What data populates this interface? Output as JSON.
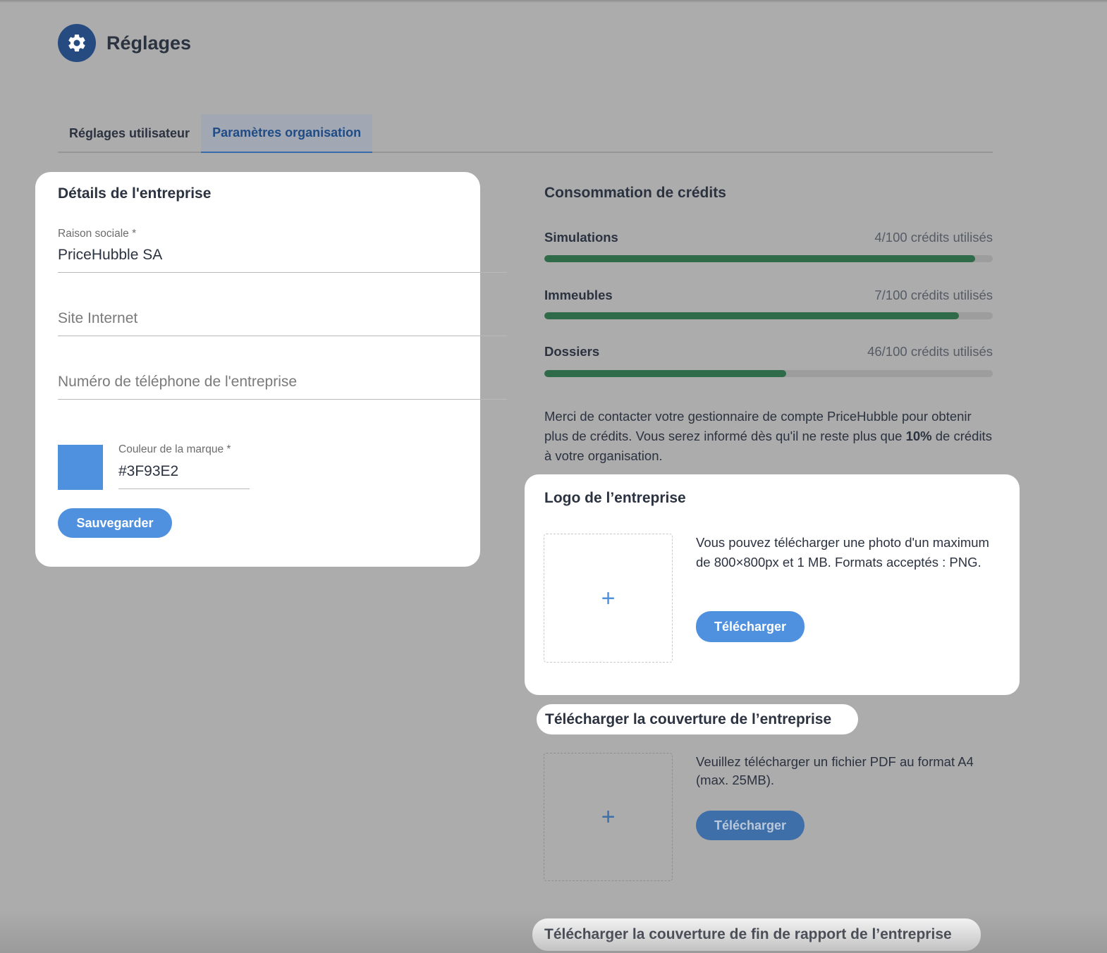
{
  "header": {
    "title": "Réglages",
    "icon": "gear-icon"
  },
  "tabs": [
    {
      "label": "Réglages utilisateur",
      "active": false
    },
    {
      "label": "Paramètres organisation",
      "active": true
    }
  ],
  "company_details": {
    "title": "Détails de l'entreprise",
    "company_name": {
      "label": "Raison sociale *",
      "value": "PriceHubble SA"
    },
    "website": {
      "placeholder": "Site Internet"
    },
    "phone": {
      "placeholder": "Numéro de téléphone de l'entreprise"
    },
    "brand_color": {
      "label": "Couleur de la marque *",
      "value": "#3F93E2",
      "swatch": "#4f90df"
    },
    "save_button": "Sauvegarder"
  },
  "credits": {
    "title": "Consommation de crédits",
    "items": [
      {
        "name": "Simulations",
        "usage": "4/100 crédits utilisés",
        "fill_percent": 96
      },
      {
        "name": "Immeubles",
        "usage": "7/100 crédits utilisés",
        "fill_percent": 92.5
      },
      {
        "name": "Dossiers",
        "usage": "46/100 crédits utilisés",
        "fill_percent": 54
      }
    ],
    "note_part1": "Merci de contacter votre gestionnaire de compte PriceHubble pour obtenir plus de crédits. Vous serez informé dès qu'il ne reste plus que ",
    "note_bold": "10%",
    "note_part2": " de crédits à votre organisation."
  },
  "logo": {
    "title": "Logo de l’entreprise",
    "description": "Vous pouvez télécharger une photo d'un maximum de 800×800px et 1 MB. Formats acceptés : PNG.",
    "upload_button": "Télécharger",
    "plus": "+"
  },
  "cover": {
    "title": "Télécharger la couverture de l’entreprise",
    "description": "Veuillez télécharger un fichier PDF au format A4 (max. 25MB).",
    "upload_button": "Télécharger",
    "plus": "+"
  },
  "end_cover": {
    "title": "Télécharger la couverture de fin de rapport de l’entreprise"
  },
  "colors": {
    "accent": "#4f90df",
    "header_icon_bg": "#254b80",
    "progress_fill": "#2f6a49",
    "active_tab_text": "#1f4c86"
  }
}
